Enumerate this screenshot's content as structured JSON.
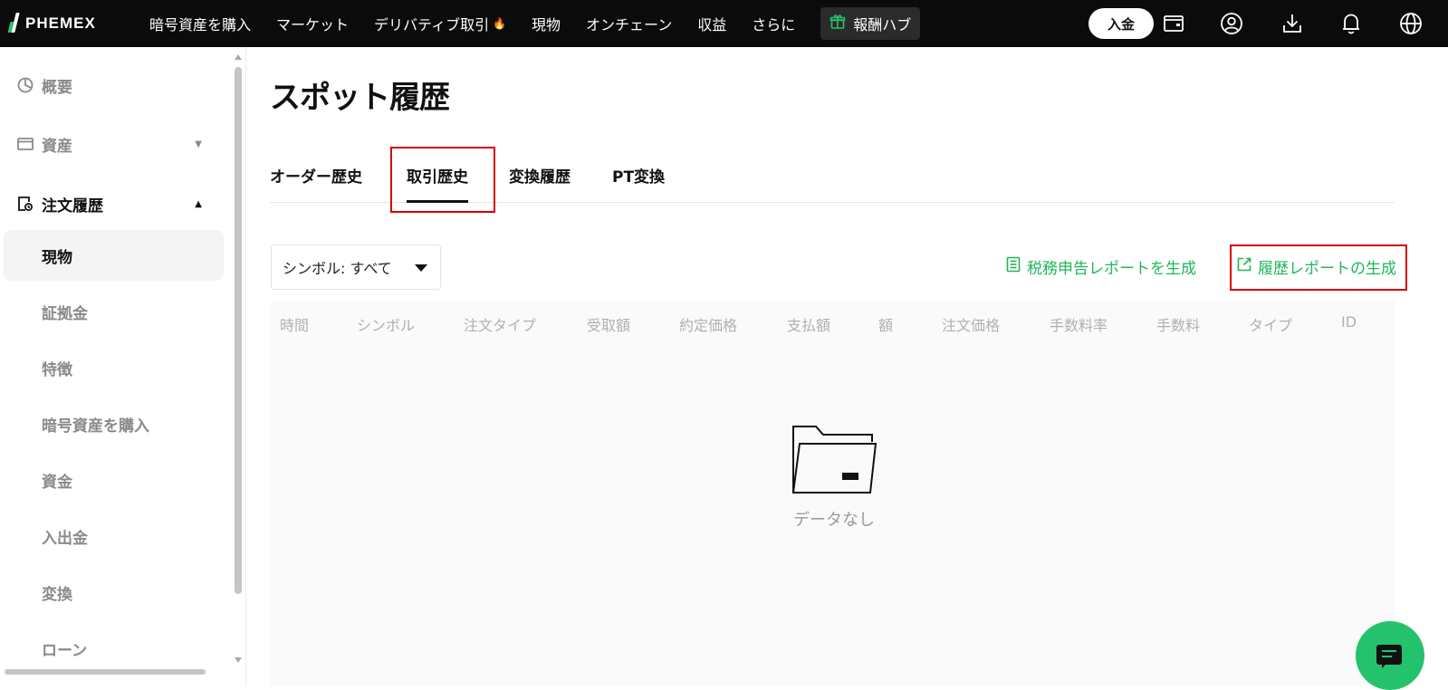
{
  "header": {
    "logo_text": "PHEMEX",
    "nav": [
      {
        "label": "暗号資産を購入"
      },
      {
        "label": "マーケット"
      },
      {
        "label": "デリバティブ取引"
      },
      {
        "label": "現物"
      },
      {
        "label": "オンチェーン"
      },
      {
        "label": "収益"
      },
      {
        "label": "さらに"
      }
    ],
    "reward_hub": "報酬ハブ",
    "deposit": "入金",
    "icons": [
      "wallet-icon",
      "user-icon",
      "download-icon",
      "bell-icon",
      "globe-icon"
    ]
  },
  "sidebar": {
    "sections": [
      {
        "label": "概要",
        "icon": "pie-chart-icon"
      },
      {
        "label": "資産",
        "icon": "wallet-icon"
      },
      {
        "label": "注文履歴",
        "icon": "order-history-icon"
      }
    ],
    "sub_items": [
      {
        "label": "現物",
        "active": true
      },
      {
        "label": "証拠金"
      },
      {
        "label": "特徴"
      },
      {
        "label": "暗号資産を購入"
      },
      {
        "label": "資金"
      },
      {
        "label": "入出金"
      },
      {
        "label": "変換"
      },
      {
        "label": "ローン"
      }
    ]
  },
  "main": {
    "title": "スポット履歴",
    "tabs": [
      {
        "label": "オーダー歴史"
      },
      {
        "label": "取引歴史",
        "active": true
      },
      {
        "label": "変換履歴"
      },
      {
        "label": "PT変換"
      }
    ],
    "symbol_filter": "シンボル: すべて",
    "tax_report": "税務申告レポートを生成",
    "history_report": "履歴レポートの生成",
    "columns": [
      "時間",
      "シンボル",
      "注文タイプ",
      "受取額",
      "約定価格",
      "支払額",
      "額",
      "注文価格",
      "手数料率",
      "手数料",
      "タイプ",
      "ID"
    ],
    "empty_text": "データなし"
  },
  "colors": {
    "accent_green": "#22b55b",
    "highlight_red": "#d40000",
    "topbar_bg": "#0b0b0b"
  }
}
